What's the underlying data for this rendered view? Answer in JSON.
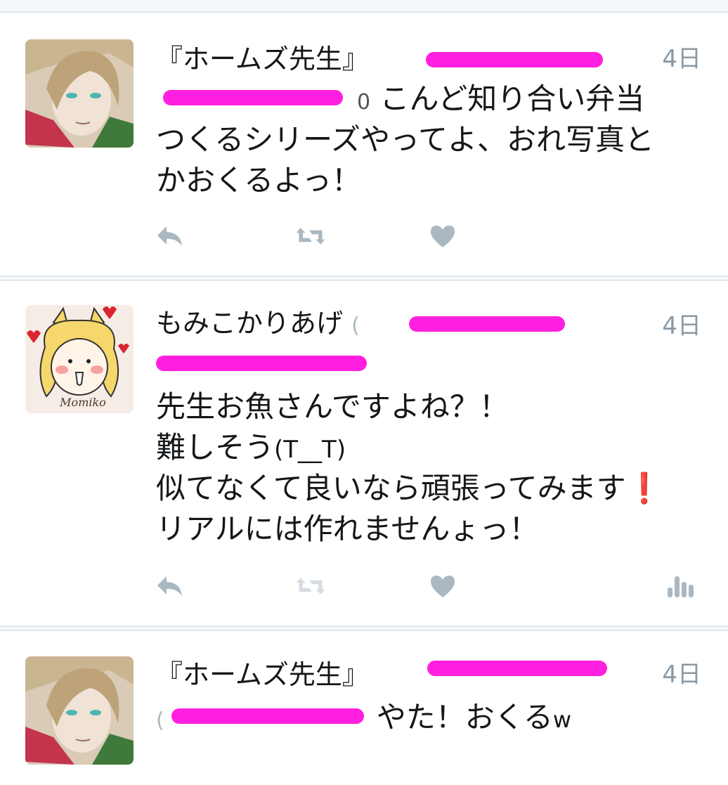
{
  "tweets": [
    {
      "name": "『ホームズ先生』",
      "date": "4日",
      "lead": "0",
      "lines": [
        "こんど知り合い弁当",
        "つくるシリーズやってよ、おれ写真と",
        "かおくるよっ！"
      ]
    },
    {
      "name": "もみこかりあげ",
      "name_suffix": "(",
      "date": "4日",
      "avatar_caption": "Momiko",
      "lines": [
        "先生お魚さんですよね？！",
        "難しそう",
        "似てなくて良いなら頑張ってみます",
        "リアルには作れませんょっ！"
      ],
      "emoticon": "(T__T)",
      "exclamation": "❗"
    },
    {
      "name": "『ホームズ先生』",
      "date": "4日",
      "lead": "(",
      "text": "やた！おくる",
      "trail": "w"
    }
  ],
  "icons": {
    "reply": "reply-icon",
    "retweet": "retweet-icon",
    "like": "heart-icon",
    "analytics": "analytics-icon"
  },
  "colors": {
    "redaction": "#ff1fe0",
    "icon": "#aab8c2",
    "date": "#8899a6",
    "divider": "#e1e8ed"
  }
}
